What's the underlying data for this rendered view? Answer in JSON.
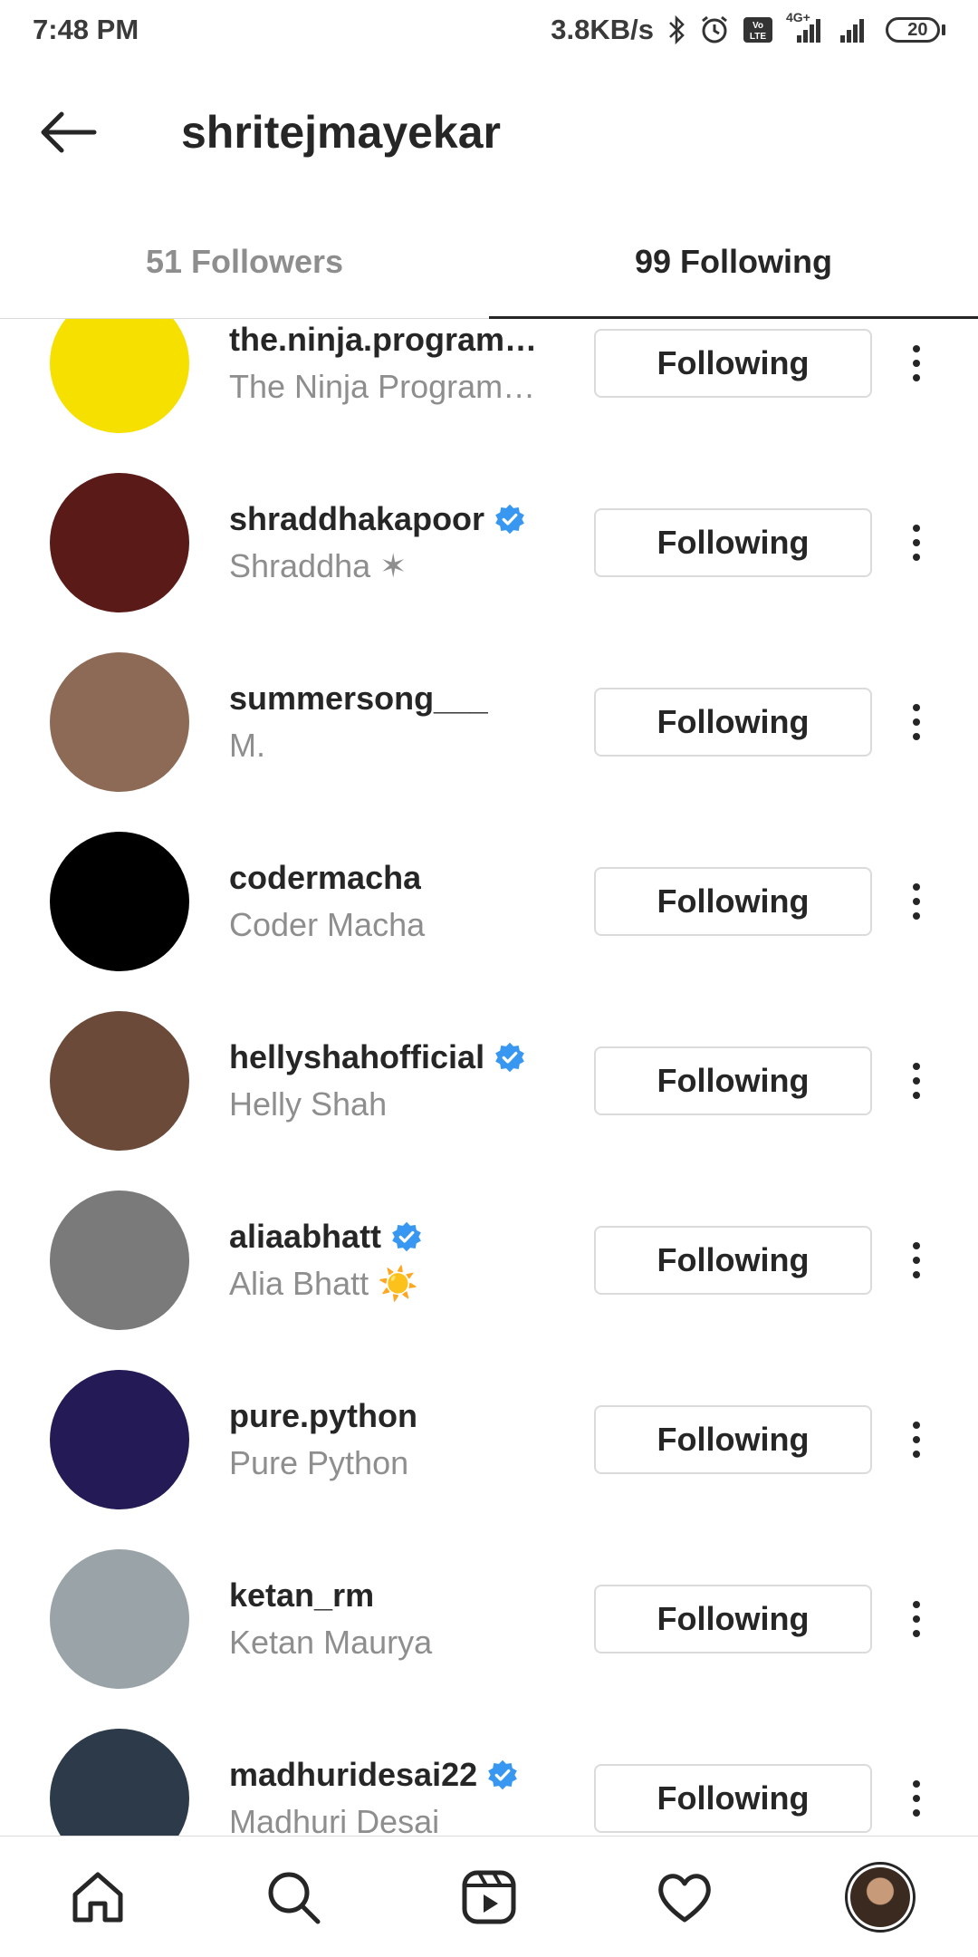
{
  "status_bar": {
    "time": "7:48 PM",
    "net_speed": "3.8KB/s",
    "network": "4G+",
    "battery": "20"
  },
  "header": {
    "title": "shritejmayekar"
  },
  "tabs": [
    {
      "label": "51 Followers",
      "active": false
    },
    {
      "label": "99 Following",
      "active": true
    }
  ],
  "following_label": "Following",
  "users": [
    {
      "username": "the.ninja.programmer",
      "fullname": "The Ninja Programmer",
      "verified": false,
      "avatar_color": "#f5e000"
    },
    {
      "username": "shraddhakapoor",
      "fullname": "Shraddha ✶",
      "verified": true,
      "avatar_color": "#5a1a18"
    },
    {
      "username": "summersong___",
      "fullname": "M.",
      "verified": false,
      "avatar_color": "#8c6a56"
    },
    {
      "username": "codermacha",
      "fullname": "Coder Macha",
      "verified": false,
      "avatar_color": "#000000"
    },
    {
      "username": "hellyshahofficial",
      "fullname": "Helly Shah",
      "verified": true,
      "avatar_color": "#6b4a3a"
    },
    {
      "username": "aliaabhatt",
      "fullname": "Alia Bhatt ☀️",
      "verified": true,
      "avatar_color": "#7a7a7a"
    },
    {
      "username": "pure.python",
      "fullname": "Pure Python",
      "verified": false,
      "avatar_color": "#241a55"
    },
    {
      "username": "ketan_rm",
      "fullname": "Ketan Maurya",
      "verified": false,
      "avatar_color": "#9aa4a8"
    },
    {
      "username": "madhuridesai22",
      "fullname": "Madhuri Desai",
      "verified": true,
      "avatar_color": "#2c3a4a"
    }
  ],
  "colors": {
    "verified": "#3897f0",
    "muted_text": "#8e8e8e",
    "primary_text": "#262626",
    "border": "#dbdbdb"
  },
  "bottom_nav": [
    {
      "name": "home-icon"
    },
    {
      "name": "search-icon"
    },
    {
      "name": "reels-icon"
    },
    {
      "name": "heart-icon"
    },
    {
      "name": "profile-avatar"
    }
  ]
}
